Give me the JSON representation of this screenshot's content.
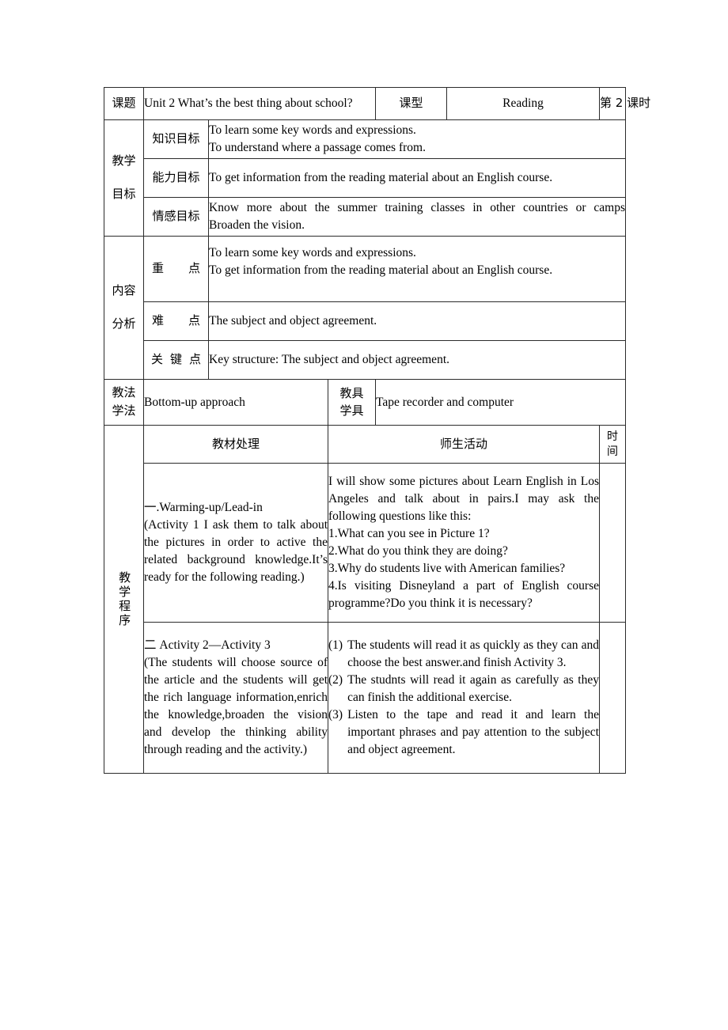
{
  "document": {
    "type": "lesson-plan-table"
  },
  "header": {
    "subject_label": "课题",
    "subject_value": "Unit 2 What’s the best thing about school?",
    "lesson_type_label": "课型",
    "lesson_type_value": "Reading",
    "period_value": "第 2 课时"
  },
  "objectives": {
    "row_label_line1": "教学",
    "row_label_line2": "目标",
    "items": [
      {
        "label": "知识目标",
        "lines": [
          "To learn some key words and expressions.",
          "To understand where a passage comes from."
        ]
      },
      {
        "label": "能力目标",
        "lines": [
          "To get information from the reading material about an English course."
        ]
      },
      {
        "label": "情感目标",
        "lines": [
          "Know more about the summer training classes in other countries or camps",
          "Broaden the vision."
        ]
      }
    ]
  },
  "analysis": {
    "row_label_line1": "内容",
    "row_label_line2": "分析",
    "items": [
      {
        "label_a": "重",
        "label_b": "点",
        "lines": [
          "To learn some key words and expressions.",
          "To get information from the reading material about an English course."
        ]
      },
      {
        "label_a": "难",
        "label_b": "点",
        "lines": [
          "The subject and object agreement."
        ]
      },
      {
        "label_k1": "关",
        "label_k2": "键",
        "label_k3": "点",
        "lines": [
          "Key structure: The subject and object agreement."
        ]
      }
    ]
  },
  "methods": {
    "label_line1": "教法",
    "label_line2": "学法",
    "value": "Bottom-up approach",
    "aids_label_line1": "教具",
    "aids_label_line2": "学具",
    "aids_value": "Tape recorder and computer"
  },
  "procedure": {
    "side_label": "教学程序",
    "col_material": "教材处理",
    "col_activity": "师生活动",
    "col_time_line1": "时",
    "col_time_line2": "间",
    "blocks": [
      {
        "material_heading": "一.Warming-up/Lead-in",
        "material_body": "(Activity 1 I ask them to talk about the pictures in order to active the related background knowledge.It’s ready for the following reading.)",
        "activity_intro": "I will show some pictures about Learn English in Los Angeles and talk about in pairs.I may ask the following questions like this:",
        "activity_questions": [
          "1.What can you see in Picture 1?",
          "2.What do you think they are doing?",
          "3.Why do students live with American families?",
          "4.Is visiting Disneyland a part of English course programme?Do you think it is necessary?"
        ]
      },
      {
        "material_heading": "二 Activity 2—Activity 3",
        "material_body": "(The students will choose source of the article and the students will get the rich language information,enrich the knowledge,broaden the vision and develop the thinking ability through reading and the activity.)",
        "activity_numbered": [
          {
            "num": "(1)",
            "text": "The students will read it as quickly as they can and choose the best answer.and finish Activity 3."
          },
          {
            "num": "(2)",
            "text": "The studnts will read it again as carefully as they can   finish the additional exercise."
          },
          {
            "num": "(3)",
            "text": "Listen to the tape and read it and learn the important phrases and pay attention to the subject and object agreement."
          }
        ]
      }
    ]
  }
}
